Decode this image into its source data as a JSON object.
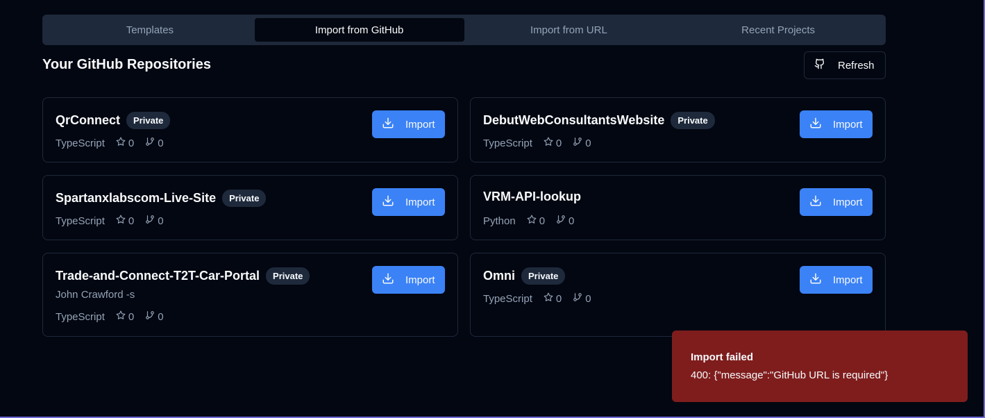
{
  "tabs": [
    {
      "label": "Templates",
      "active": false
    },
    {
      "label": "Import from GitHub",
      "active": true
    },
    {
      "label": "Import from URL",
      "active": false
    },
    {
      "label": "Recent Projects",
      "active": false
    }
  ],
  "section_title": "Your GitHub Repositories",
  "refresh_label": "Refresh",
  "import_label": "Import",
  "repos": [
    {
      "name": "QrConnect",
      "badge": "Private",
      "description": "",
      "language": "TypeScript",
      "stars": "0",
      "forks": "0"
    },
    {
      "name": "DebutWebConsultantsWebsite",
      "badge": "Private",
      "description": "",
      "language": "TypeScript",
      "stars": "0",
      "forks": "0"
    },
    {
      "name": "Spartanxlabscom-Live-Site",
      "badge": "Private",
      "description": "",
      "language": "TypeScript",
      "stars": "0",
      "forks": "0"
    },
    {
      "name": "VRM-API-lookup",
      "badge": "",
      "description": "",
      "language": "Python",
      "stars": "0",
      "forks": "0"
    },
    {
      "name": "Trade-and-Connect-T2T-Car-Portal",
      "badge": "Private",
      "description": "John Crawford -s",
      "language": "TypeScript",
      "stars": "0",
      "forks": "0"
    },
    {
      "name": "Omni",
      "badge": "Private",
      "description": "",
      "language": "TypeScript",
      "stars": "0",
      "forks": "0"
    }
  ],
  "toast": {
    "title": "Import failed",
    "message": "400: {\"message\":\"GitHub URL is required\"}"
  },
  "colors": {
    "background": "#030711",
    "accent": "#3b82f6",
    "error": "#7f1d1d"
  }
}
